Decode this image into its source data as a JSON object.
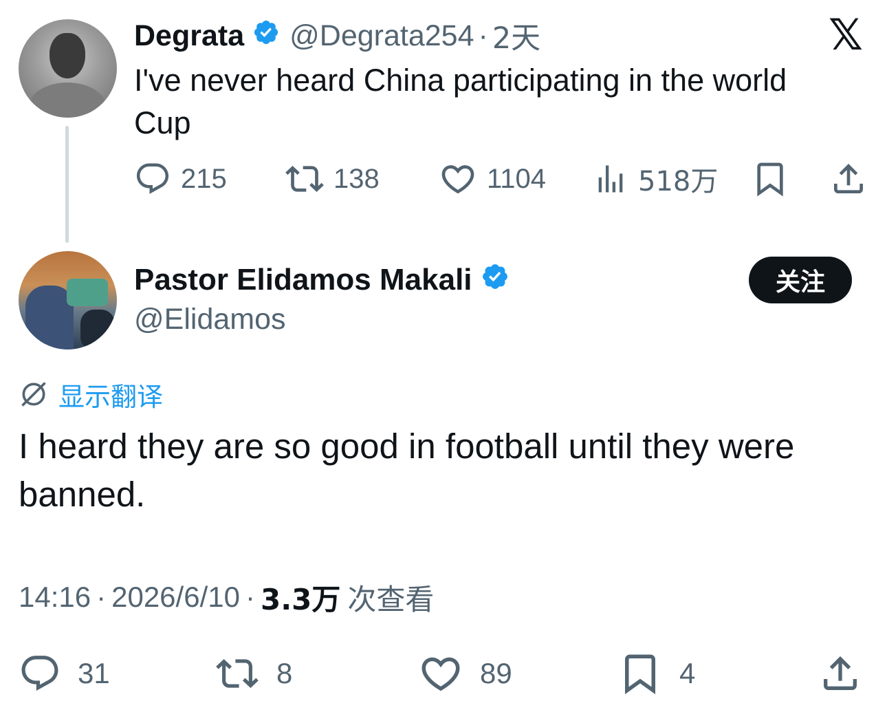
{
  "parent_tweet": {
    "name": "Degrata",
    "handle": "@Degrata254",
    "separator": "·",
    "time": "2天",
    "text": "I've never heard China participating in the world Cup",
    "actions": {
      "replies": "215",
      "retweets": "138",
      "likes": "1104",
      "views": "518万"
    }
  },
  "brand": {
    "logo": "𝕏"
  },
  "reply_tweet": {
    "name": "Pastor Elidamos Makali",
    "handle": "@Elidamos",
    "follow_label": "关注",
    "translate_label": "显示翻译",
    "text": "I heard they are so good in football until they were banned.",
    "meta": {
      "time": "14:16",
      "separator": "·",
      "date": "2026/6/10",
      "views_count": "3.3万",
      "views_label": "次查看"
    },
    "actions": {
      "replies": "31",
      "retweets": "8",
      "likes": "89",
      "bookmarks": "4"
    }
  },
  "colors": {
    "text": "#0f1419",
    "secondary": "#536471",
    "accent": "#1d9bf0",
    "thread_line": "#cfd9de"
  },
  "icons": [
    "reply-icon",
    "retweet-icon",
    "like-icon",
    "views-icon",
    "bookmark-icon",
    "share-icon",
    "verified-badge-icon",
    "translate-icon",
    "x-logo"
  ]
}
